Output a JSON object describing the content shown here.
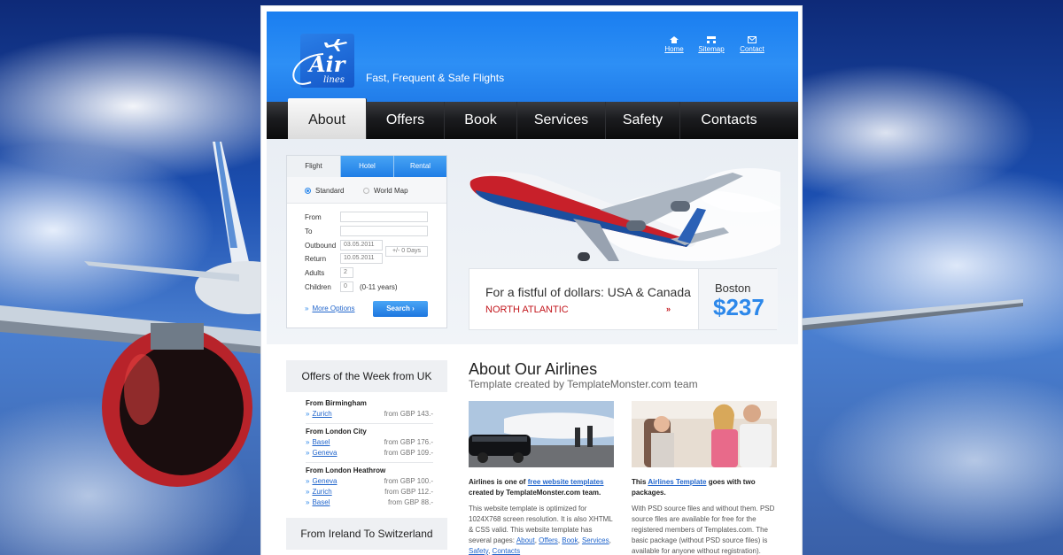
{
  "header": {
    "logo": {
      "text": "Air",
      "sub": "lines"
    },
    "tagline": "Fast, Frequent & Safe Flights",
    "links": [
      {
        "label": "Home",
        "icon": "home-icon"
      },
      {
        "label": "Sitemap",
        "icon": "sitemap-icon"
      },
      {
        "label": "Contact",
        "icon": "mail-icon"
      }
    ]
  },
  "nav": {
    "active": "About",
    "items": [
      "About",
      "Offers",
      "Book",
      "Services",
      "Safety",
      "Contacts"
    ]
  },
  "search": {
    "tabs": [
      "Flight",
      "Hotel",
      "Rental"
    ],
    "radios": [
      "Standard",
      "World Map"
    ],
    "from_label": "From",
    "to_label": "To",
    "outbound_label": "Outbound",
    "outbound_value": "03.05.2011",
    "return_label": "Return",
    "return_value": "10.05.2011",
    "days_label": "+/- 0 Days",
    "adults_label": "Adults",
    "adults_value": "2",
    "children_label": "Children",
    "children_value": "0",
    "children_note": "(0-11 years)",
    "more_options": "More Options",
    "search_button": "Search",
    "chevron": "»"
  },
  "promo": {
    "title": "For a fistful of dollars: USA & Canada",
    "subtitle": "NORTH ATLANTIC",
    "arrow": "»",
    "city": "Boston",
    "price": "$237"
  },
  "offers": {
    "title": "Offers of the Week from UK",
    "chevron": "»",
    "groups": [
      {
        "name": "From Birmingham",
        "items": [
          {
            "city": "Zurich",
            "price": "from GBP 143.-"
          }
        ]
      },
      {
        "name": "From London City",
        "items": [
          {
            "city": "Basel",
            "price": "from GBP 176.-"
          },
          {
            "city": "Geneva",
            "price": "from GBP 109.-"
          }
        ]
      },
      {
        "name": "From London Heathrow",
        "items": [
          {
            "city": "Geneva",
            "price": "from GBP 100.-"
          },
          {
            "city": "Zurich",
            "price": "from GBP 112.-"
          },
          {
            "city": "Basel",
            "price": "from GBP 88.-"
          }
        ]
      }
    ],
    "title2": "From Ireland To Switzerland"
  },
  "about": {
    "title": "About Our Airlines",
    "subtitle": "Template created by TemplateMonster.com team",
    "col1": {
      "head_pre": "Airlines is one of ",
      "head_link": "free website templates",
      "head_post": " created by TemplateMonster.com team.",
      "text_pre": "This website template is optimized for 1024X768 screen resolution. It is also XHTML & CSS valid. This website template has several pages: ",
      "links": [
        "About",
        "Offers",
        "Book",
        "Services",
        "Safety",
        "Contacts"
      ],
      "sep": ", "
    },
    "col2": {
      "head_pre": "This ",
      "head_link": "Airlines Template",
      "head_post": " goes with two packages.",
      "text": "With PSD source files and without them. PSD source files are available for free for the registered members of Templates.com. The basic package (without PSD source files) is available for anyone without registration)."
    }
  },
  "colors": {
    "accent": "#2d88ea",
    "header_blue": "#1a7ef0",
    "promo_red": "#c3161c",
    "link": "#2266cc"
  }
}
